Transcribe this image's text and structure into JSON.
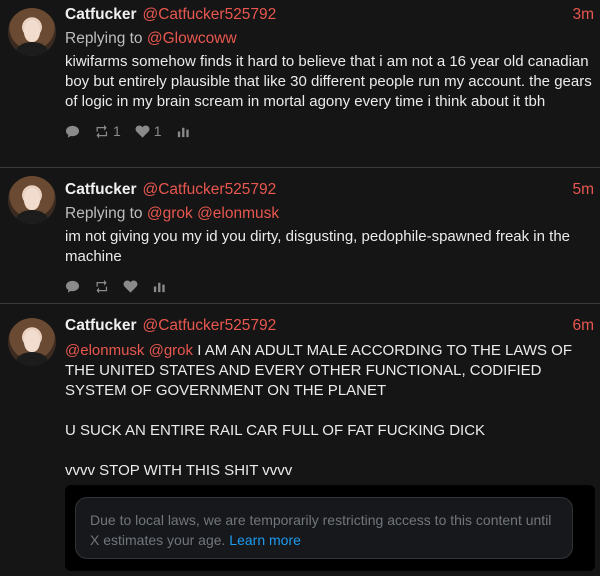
{
  "tweets": [
    {
      "name": "Catfucker",
      "handle": "@Catfucker525792",
      "time": "3m",
      "reply_prefix": "Replying to",
      "reply_to": [
        "@Glowcoww"
      ],
      "body": "kiwifarms somehow finds it hard to believe that i am not a 16 year old canadian boy but entirely plausible that like 30 different people run my account. the gears of logic in my brain scream in mortal agony every time i think about it tbh",
      "retweets": "1",
      "likes": "1"
    },
    {
      "name": "Catfucker",
      "handle": "@Catfucker525792",
      "time": "5m",
      "reply_prefix": "Replying to",
      "reply_to": [
        "@grok",
        "@elonmusk"
      ],
      "body": "im not giving you my id you dirty, disgusting, pedophile-spawned freak in the machine",
      "retweets": "",
      "likes": ""
    },
    {
      "name": "Catfucker",
      "handle": "@Catfucker525792",
      "time": "6m",
      "mentions": [
        "@elonmusk",
        "@grok"
      ],
      "body_first": "I AM AN ADULT MALE ACCORDING TO THE LAWS OF THE UNITED STATES AND EVERY OTHER FUNCTIONAL, CODIFIED SYSTEM OF GOVERNMENT ON THE PLANET",
      "body_second": "U SUCK AN ENTIRE RAIL CAR FULL OF FAT FUCKING DICK",
      "body_third": "vvvv STOP WITH THIS SHIT vvvv",
      "embed_notice": "Due to local laws, we are temporarily restricting access to this content until X estimates your age.",
      "embed_link": "Learn more"
    }
  ],
  "icons": {
    "reply": "comment-icon",
    "retweet": "retweet-icon",
    "like": "heart-icon",
    "stats": "bar-chart-icon"
  },
  "colors": {
    "background": "#151515",
    "accent": "#e8574f",
    "link": "#1d9bf0"
  }
}
